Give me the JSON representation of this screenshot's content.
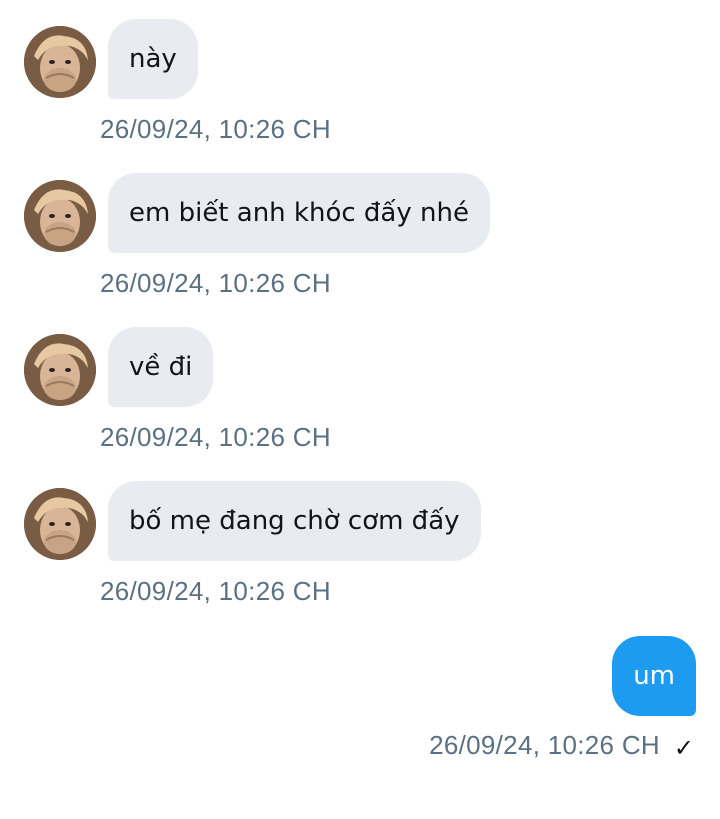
{
  "messages": [
    {
      "sender": "other",
      "text": "này",
      "time": "26/09/24, 10:26 CH"
    },
    {
      "sender": "other",
      "text": "em biết anh khóc đấy nhé",
      "time": "26/09/24, 10:26 CH"
    },
    {
      "sender": "other",
      "text": "về đi",
      "time": "26/09/24, 10:26 CH"
    },
    {
      "sender": "other",
      "text": "bố mẹ đang chờ cơm đấy",
      "time": "26/09/24, 10:26 CH"
    },
    {
      "sender": "self",
      "text": "um",
      "time": "26/09/24, 10:26 CH",
      "status_icon": "checkmark-icon",
      "status_glyph": "✓"
    }
  ],
  "colors": {
    "incoming_bubble": "#e8ecf0",
    "outgoing_bubble": "#1d9bf0",
    "timestamp": "#5b7083"
  }
}
